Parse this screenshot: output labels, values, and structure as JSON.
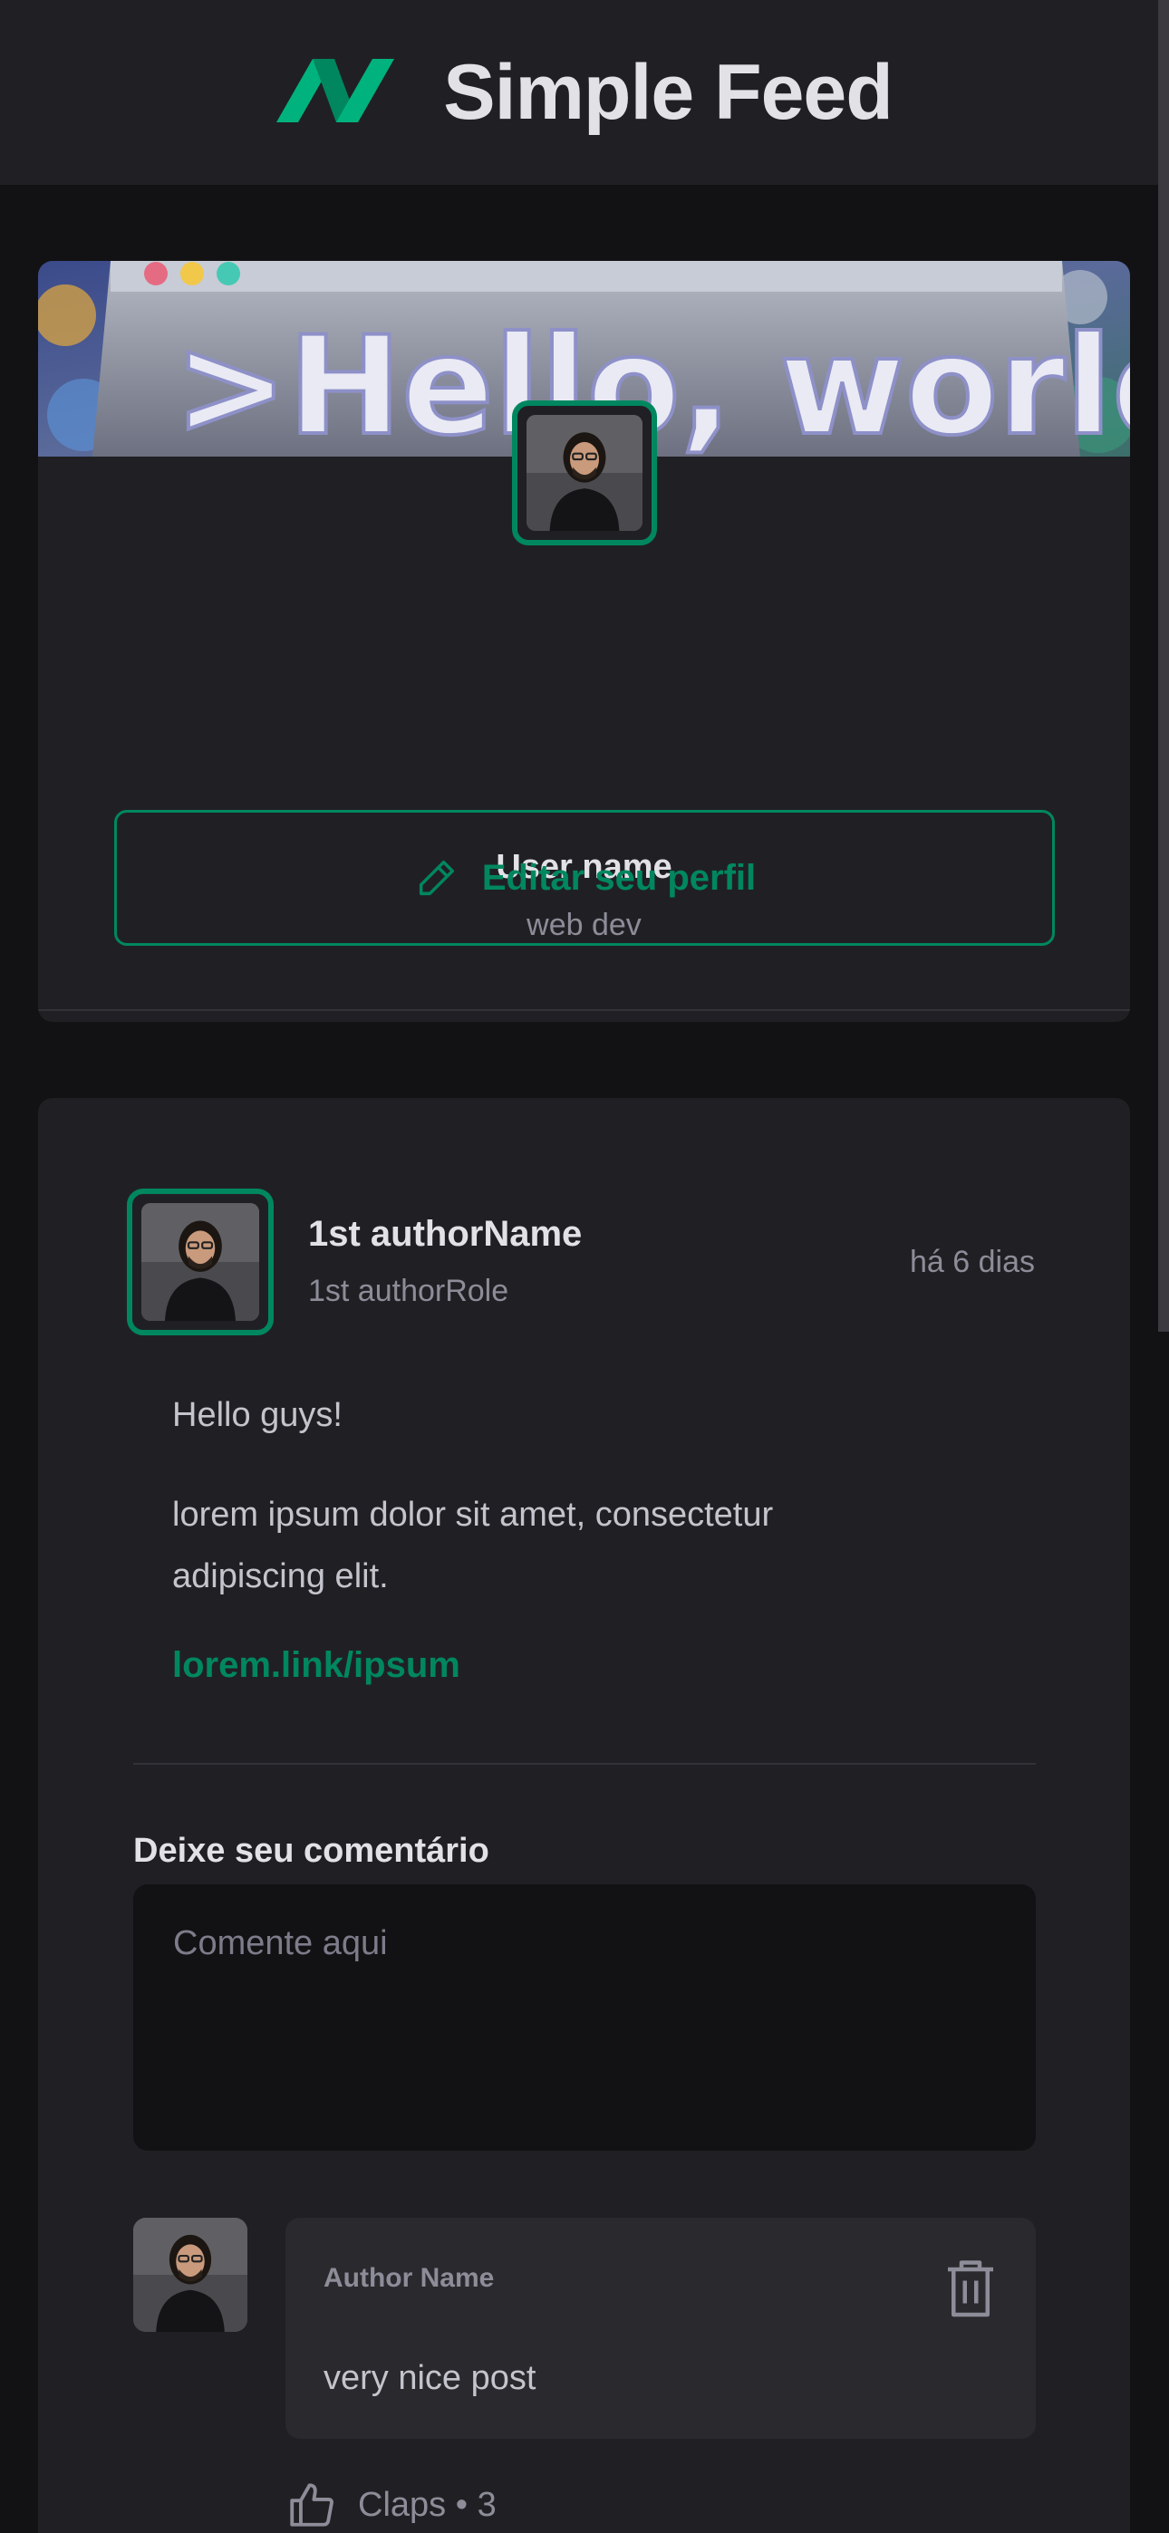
{
  "header": {
    "app_title": "Simple Feed",
    "logo_icon": "simple-feed-logo-icon",
    "brand_color": "#00875f"
  },
  "profile": {
    "cover_text": ">Hello, world!_",
    "name": "User name",
    "role": "web dev",
    "edit_button_label": "Editar seu perfil",
    "edit_icon": "pencil-icon"
  },
  "post": {
    "author_name": "1st authorName",
    "author_role": "1st authorRole",
    "published_relative": "há 6 dias",
    "content": [
      "Hello guys!",
      "lorem ipsum dolor sit amet, consectetur adipiscing elit."
    ],
    "link": "lorem.link/ipsum",
    "comment_form": {
      "label": "Deixe seu comentário",
      "placeholder": "Comente aqui"
    },
    "comments": [
      {
        "author": "Author Name",
        "text": "very nice post",
        "claps_label": "Claps • 3",
        "delete_icon": "trash-icon",
        "clap_icon": "thumbs-up-icon"
      }
    ]
  }
}
